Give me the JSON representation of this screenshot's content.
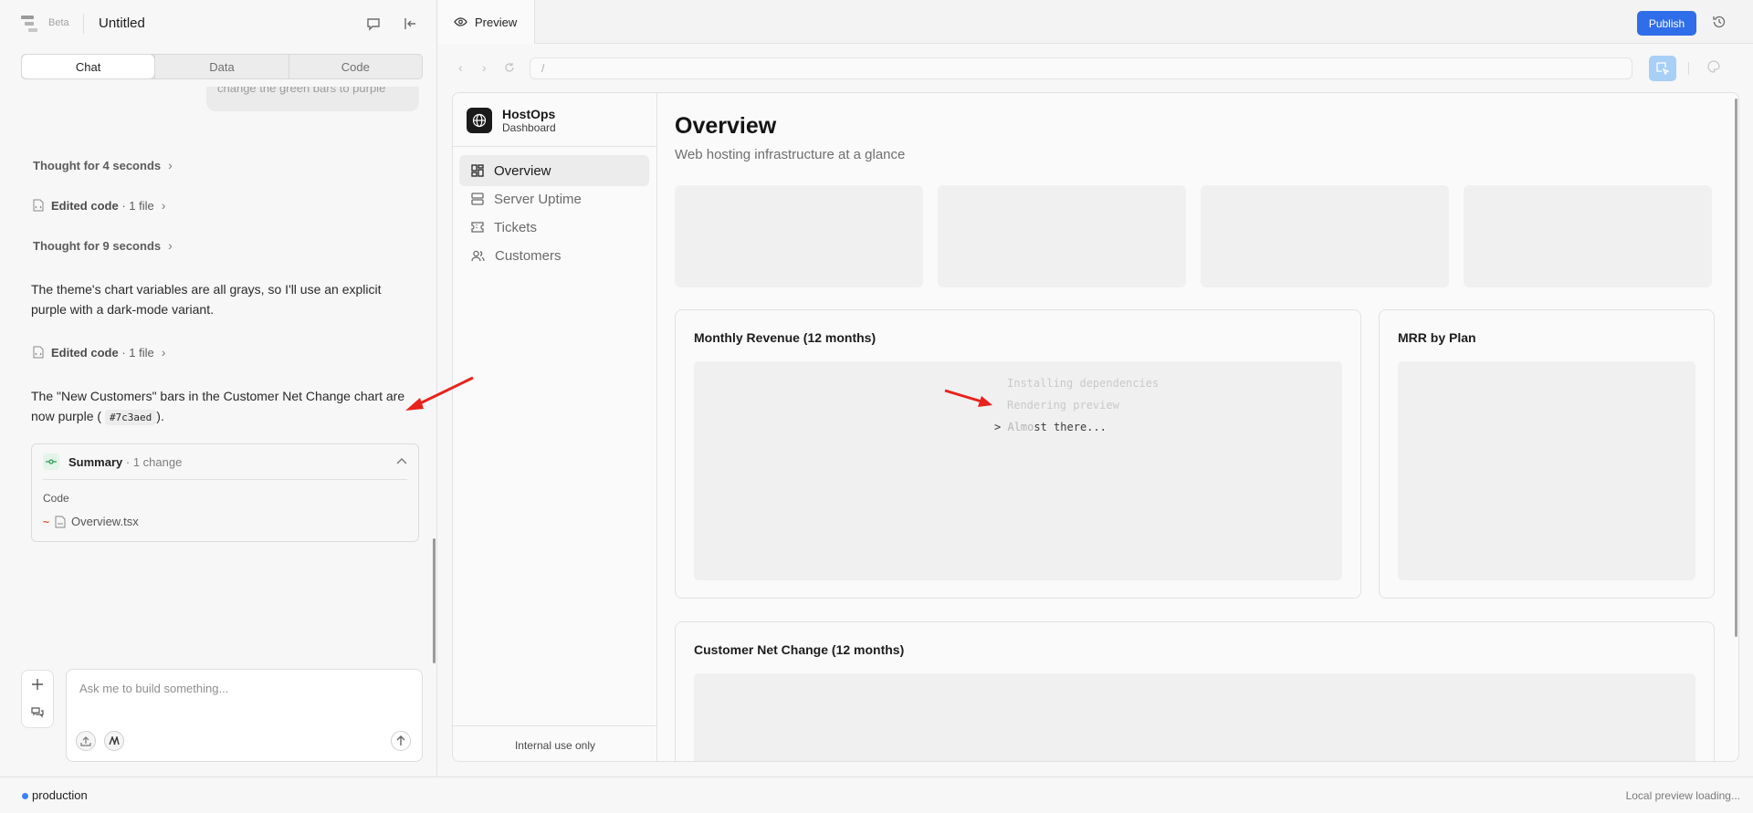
{
  "app": {
    "beta_label": "Beta",
    "doc_title": "Untitled"
  },
  "left_tabs": [
    "Chat",
    "Data",
    "Code"
  ],
  "chat": {
    "prev_user_msg": "change the green bars to purple",
    "thought1": "Thought for 4 seconds",
    "edited1_label": "Edited code",
    "edited1_meta": "· 1 file",
    "thought2": "Thought for 9 seconds",
    "message1": "The theme's chart variables are all grays, so I'll use an explicit purple with a dark-mode variant.",
    "edited2_label": "Edited code",
    "edited2_meta": "· 1 file",
    "message2_pre": "The \"New Customers\" bars in the Customer Net Change chart are now purple (",
    "message2_code": "#7c3aed",
    "message2_post": ")."
  },
  "summary": {
    "title": "Summary",
    "meta": "· 1 change",
    "section": "Code",
    "file": "Overview.tsx",
    "change_mark": "~"
  },
  "composer": {
    "placeholder": "Ask me to build something..."
  },
  "preview": {
    "tab_label": "Preview",
    "publish_label": "Publish",
    "url": "/"
  },
  "dashboard": {
    "brand_name": "HostOps",
    "brand_sub": "Dashboard",
    "nav": [
      "Overview",
      "Server Uptime",
      "Tickets",
      "Customers"
    ],
    "footer": "Internal use only",
    "title": "Overview",
    "subtitle": "Web hosting infrastructure at a glance",
    "card1_title": "Monthly Revenue (12 months)",
    "card2_title": "MRR by Plan",
    "card3_title": "Customer Net Change (12 months)",
    "loading": {
      "line1": "Installing dependencies",
      "line2": "Rendering preview",
      "line3_prompt": ">",
      "line3_bold": "Almo",
      "line3_faded": "st",
      "line3_rest": " there..."
    }
  },
  "statusbar": {
    "env": "production",
    "right": "Local preview loading..."
  },
  "colors": {
    "accent": "#2f6ee8",
    "annotation": "#e8221c",
    "env_dot": "#3b82f6"
  }
}
